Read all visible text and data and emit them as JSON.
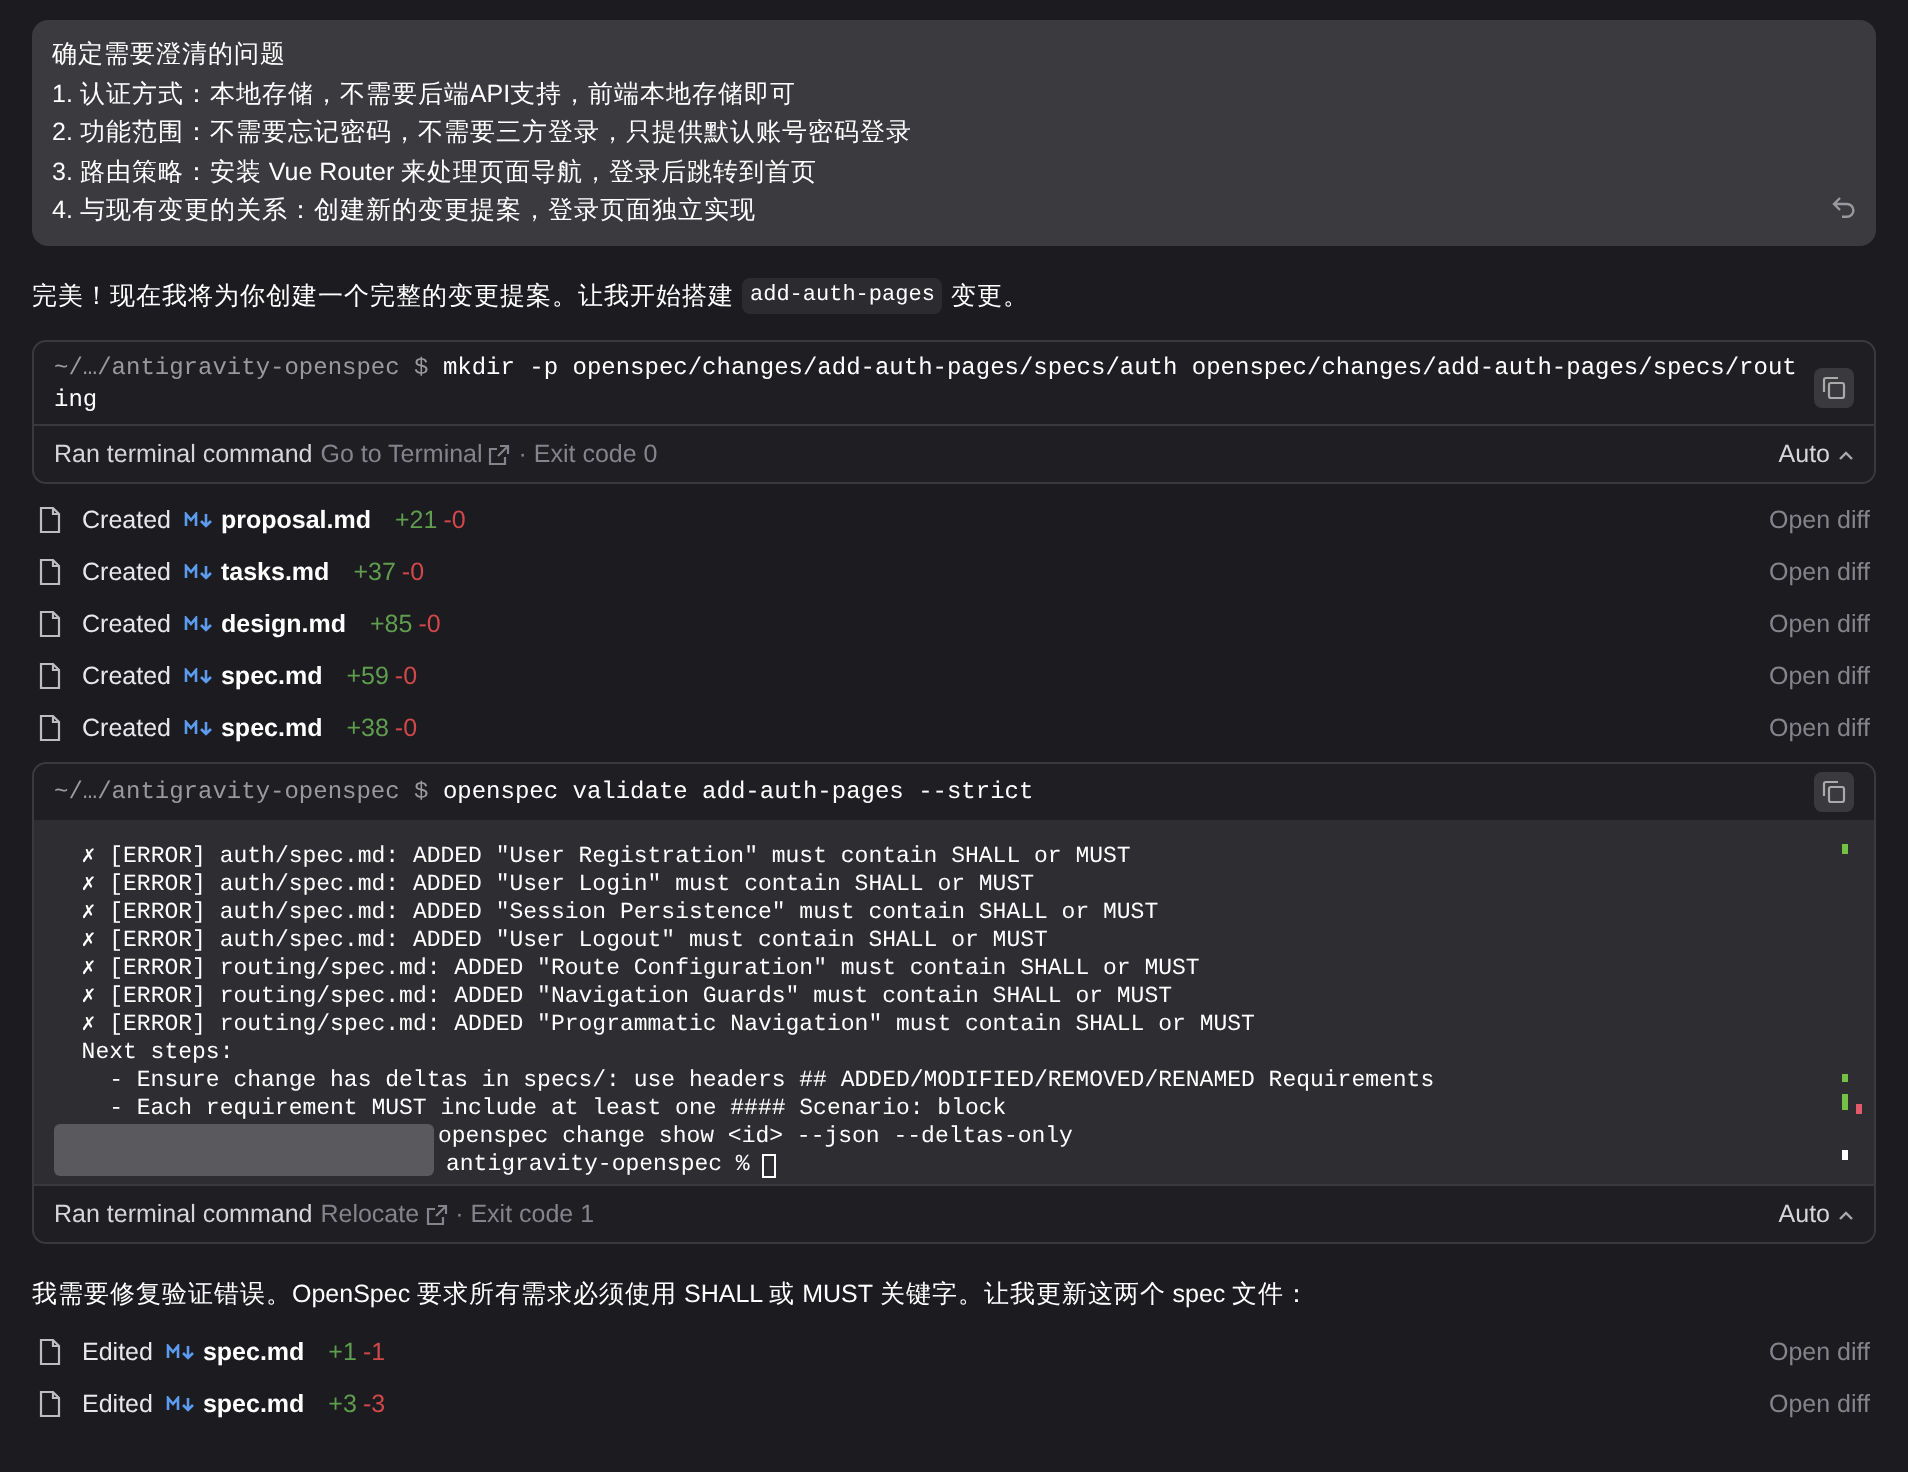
{
  "user_message": {
    "lines": [
      "确定需要澄清的问题",
      "1. 认证方式：本地存储，不需要后端API支持，前端本地存储即可",
      "2. 功能范围：不需要忘记密码，不需要三方登录，只提供默认账号密码登录",
      "3. 路由策略：安装 Vue Router 来处理页面导航，登录后跳转到首页",
      "4. 与现有变更的关系：创建新的变更提案，登录页面独立实现"
    ]
  },
  "assistant_text_1": {
    "before": "完美！现在我将为你创建一个完整的变更提案。让我开始搭建",
    "code": "add-auth-pages",
    "after": "变更。"
  },
  "terminal_1": {
    "prompt": "~/…/antigravity-openspec $",
    "command": "mkdir -p openspec/changes/add-auth-pages/specs/auth openspec/changes/add-auth-pages/specs/routing",
    "status": "Ran terminal command",
    "link": "Go to Terminal",
    "exit": "· Exit code 0",
    "mode": "Auto"
  },
  "file_changes_1": [
    {
      "action": "Created",
      "file": "proposal.md",
      "added": "+21",
      "removed": "-0",
      "link": "Open diff"
    },
    {
      "action": "Created",
      "file": "tasks.md",
      "added": "+37",
      "removed": "-0",
      "link": "Open diff"
    },
    {
      "action": "Created",
      "file": "design.md",
      "added": "+85",
      "removed": "-0",
      "link": "Open diff"
    },
    {
      "action": "Created",
      "file": "spec.md",
      "added": "+59",
      "removed": "-0",
      "link": "Open diff"
    },
    {
      "action": "Created",
      "file": "spec.md",
      "added": "+38",
      "removed": "-0",
      "link": "Open diff"
    }
  ],
  "terminal_2": {
    "prompt": "~/…/antigravity-openspec $",
    "command": "openspec validate add-auth-pages --strict",
    "output": [
      "  ✗ [ERROR] auth/spec.md: ADDED \"User Registration\" must contain SHALL or MUST",
      "  ✗ [ERROR] auth/spec.md: ADDED \"User Login\" must contain SHALL or MUST",
      "  ✗ [ERROR] auth/spec.md: ADDED \"Session Persistence\" must contain SHALL or MUST",
      "  ✗ [ERROR] auth/spec.md: ADDED \"User Logout\" must contain SHALL or MUST",
      "  ✗ [ERROR] routing/spec.md: ADDED \"Route Configuration\" must contain SHALL or MUST",
      "  ✗ [ERROR] routing/spec.md: ADDED \"Navigation Guards\" must contain SHALL or MUST",
      "  ✗ [ERROR] routing/spec.md: ADDED \"Programmatic Navigation\" must contain SHALL or MUST",
      "  Next steps:",
      "    - Ensure change has deltas in specs/: use headers ## ADDED/MODIFIED/REMOVED/RENAMED Requirements",
      "    - Each requirement MUST include at least one #### Scenario: block"
    ],
    "partial_line": "openspec change show <id> --json --deltas-only",
    "shell_prompt": "antigravity-openspec %",
    "status": "Ran terminal command",
    "link": "Relocate",
    "exit": "· Exit code 1",
    "mode": "Auto"
  },
  "assistant_text_2": "我需要修复验证错误。OpenSpec 要求所有需求必须使用 SHALL 或 MUST 关键字。让我更新这两个 spec 文件：",
  "file_changes_2": [
    {
      "action": "Edited",
      "file": "spec.md",
      "added": "+1",
      "removed": "-1",
      "link": "Open diff"
    },
    {
      "action": "Edited",
      "file": "spec.md",
      "added": "+3",
      "removed": "-3",
      "link": "Open diff"
    }
  ]
}
